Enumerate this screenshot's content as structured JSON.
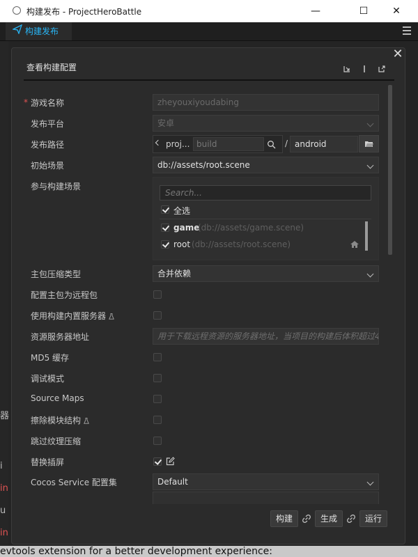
{
  "window": {
    "title": "构建发布 - ProjectHeroBattle",
    "minimize": "—",
    "maximize": "☐",
    "close": "✕"
  },
  "tab": {
    "label": "构建发布"
  },
  "dialog": {
    "title": "查看构建配置",
    "fields": {
      "game_name": {
        "label": "游戏名称",
        "value": "zheyouxiyoudabing"
      },
      "platform": {
        "label": "发布平台",
        "value": "安卓"
      },
      "build_path": {
        "label": "发布路径",
        "prefix": "proj...",
        "placeholder": "build",
        "separator": "/",
        "value": "android"
      },
      "start_scene": {
        "label": "初始场景",
        "value": "db://assets/root.scene"
      },
      "included_scenes": {
        "label": "参与构建场景",
        "search_placeholder": "Search...",
        "select_all": "全选",
        "scenes": [
          {
            "name": "game",
            "path": "(db://assets/game.scene)"
          },
          {
            "name": "root",
            "path": "(db://assets/root.scene)"
          }
        ]
      },
      "compression": {
        "label": "主包压缩类型",
        "value": "合并依赖"
      },
      "remote_bundle": {
        "label": "配置主包为远程包"
      },
      "builtin_server": {
        "label": "使用构建内置服务器"
      },
      "server_url": {
        "label": "资源服务器地址",
        "placeholder": "用于下载远程资源的服务器地址，当项目的构建后体积超过4M"
      },
      "md5": {
        "label": "MD5 缓存"
      },
      "debug": {
        "label": "调试模式"
      },
      "source_maps": {
        "label": "Source Maps"
      },
      "erase_modules": {
        "label": "擦除模块结构"
      },
      "skip_texture": {
        "label": "跳过纹理压缩"
      },
      "splash": {
        "label": "替换插屏"
      },
      "cocos_service": {
        "label": "Cocos Service 配置集",
        "value": "Default"
      }
    },
    "buttons": {
      "build": "构建",
      "make": "生成",
      "run": "运行"
    }
  },
  "background": {
    "bleed_labels": [
      "器",
      "i",
      "in",
      "u",
      "in"
    ],
    "bottom_text": "evtools extension for a better development experience:"
  }
}
